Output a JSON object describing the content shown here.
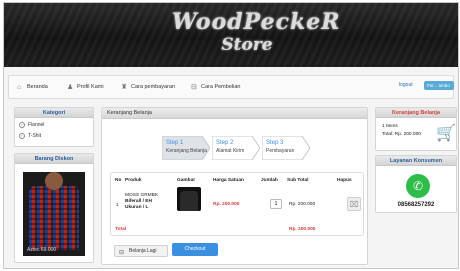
{
  "logo": {
    "line1": "WoodPeckeR",
    "line2": "Store"
  },
  "nav": {
    "items": [
      {
        "label": "Beranda",
        "icon": "home-icon"
      },
      {
        "label": "Profil Kami",
        "icon": "user-icon"
      },
      {
        "label": "Cara pembayaran",
        "icon": "wallet-icon"
      },
      {
        "label": "Cara Pembelian",
        "icon": "cart-icon"
      }
    ],
    "logout_label": "logout",
    "user_label": "Fer... ambo"
  },
  "kategori": {
    "title": "Kategori",
    "items": [
      {
        "label": "Flannel"
      },
      {
        "label": "T-Shit"
      }
    ]
  },
  "diskon": {
    "title": "Barang Diskon",
    "caption": "Aztec 69.000"
  },
  "main": {
    "header": "Keranjang Belanja",
    "steps": [
      {
        "title": "Step 1",
        "subtitle": "Keranjang Belanja"
      },
      {
        "title": "Step 2",
        "subtitle": "Alamat Kirim"
      },
      {
        "title": "Step 3",
        "subtitle": "Pembayaran"
      }
    ],
    "table": {
      "headers": [
        "No",
        "Produk",
        "Gambar",
        "Harga Satuan",
        "Jumlah",
        "Sub Total",
        "Hapus"
      ],
      "rows": [
        {
          "no": "1",
          "produk": [
            "MOSS GRMBK",
            "Biferall / EH",
            "Ukuran / L"
          ],
          "harga": "Rp. 200.000",
          "jumlah": "1",
          "subtotal": "Rp. 200.000"
        }
      ],
      "total_label": "Total",
      "total_value": "Rp. 200.000"
    },
    "back_label": "Belanja Lagi",
    "checkout_label": "Checkout"
  },
  "keranjang": {
    "title": "Keranjang Belanja",
    "items_line": "1 Items",
    "total_line": "Total: Rp. 200.000"
  },
  "layanan": {
    "title": "Layanan Konsumen",
    "phone": "08568257292"
  },
  "colors": {
    "accent_blue": "#3b8fe0",
    "price_red": "#d83a3a",
    "whatsapp_green": "#2ebd49"
  }
}
